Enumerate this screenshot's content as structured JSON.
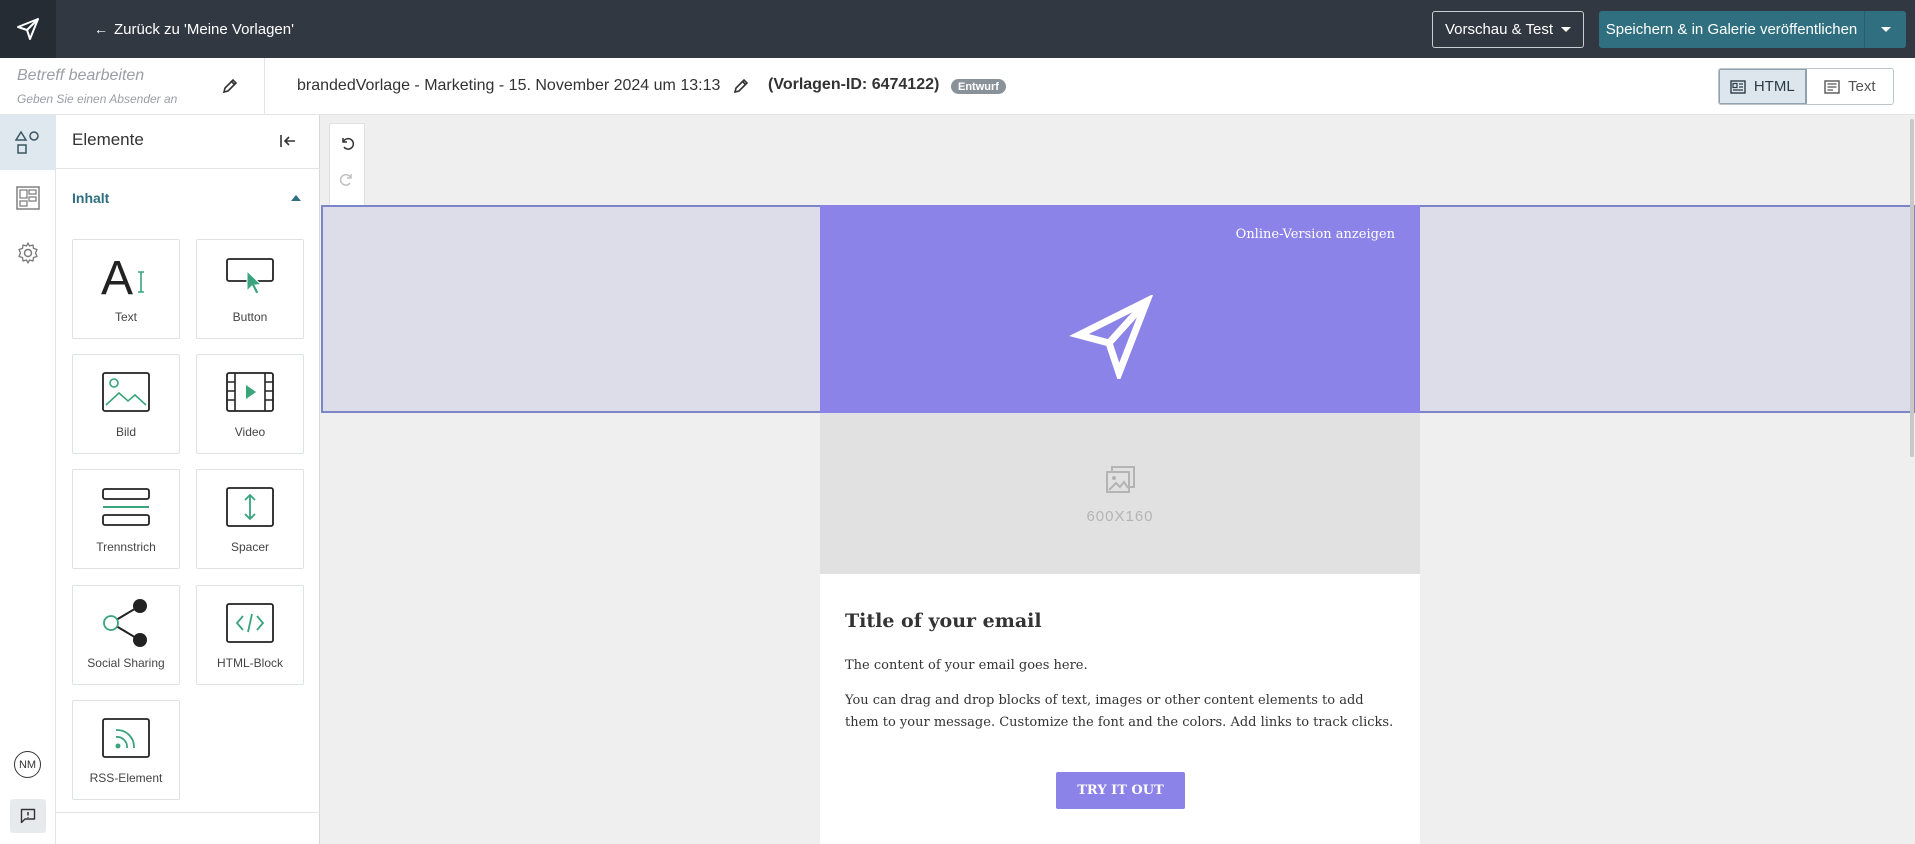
{
  "topbar": {
    "logo_icon": "paper-plane-icon",
    "back_label": "Zurück zu 'Meine Vorlagen'",
    "preview_label": "Vorschau & Test",
    "save_label": "Speichern & in Galerie veröffentlichen"
  },
  "subheader": {
    "subject_title": "Betreff bearbeiten",
    "subject_sender": "Geben Sie einen Absender an",
    "template_name": "brandedVorlage - Marketing - 15. November 2024 um 13:13",
    "template_id": "(Vorlagen-ID: 6474122)",
    "status_badge": "Entwurf",
    "mode_html": "HTML",
    "mode_text": "Text"
  },
  "rail": {
    "items": [
      "elements-icon",
      "layout-blocks-icon",
      "settings-icon"
    ],
    "avatar_initials": "NM"
  },
  "panel": {
    "title": "Elemente",
    "section": "Inhalt",
    "tiles": [
      {
        "label": "Text",
        "icon": "text-icon"
      },
      {
        "label": "Button",
        "icon": "button-icon"
      },
      {
        "label": "Bild",
        "icon": "image-icon"
      },
      {
        "label": "Video",
        "icon": "video-icon"
      },
      {
        "label": "Trennstrich",
        "icon": "divider-icon"
      },
      {
        "label": "Spacer",
        "icon": "spacer-icon"
      },
      {
        "label": "Social Sharing",
        "icon": "share-icon"
      },
      {
        "label": "HTML-Block",
        "icon": "code-icon"
      },
      {
        "label": "RSS-Element",
        "icon": "rss-icon"
      }
    ]
  },
  "email": {
    "online_link": "Online-Version anzeigen",
    "image_placeholder": "600X160",
    "title": "Title of your email",
    "p1": "The content of your email goes here.",
    "p2": "You can drag and drop blocks of text, images or other content elements to add them to your message. Customize the font and the colors. Add links to track clicks.",
    "cta": "TRY IT OUT"
  },
  "colors": {
    "topbar": "#313842",
    "accent": "#2f6f80",
    "brand_purple": "#8c83e8"
  }
}
